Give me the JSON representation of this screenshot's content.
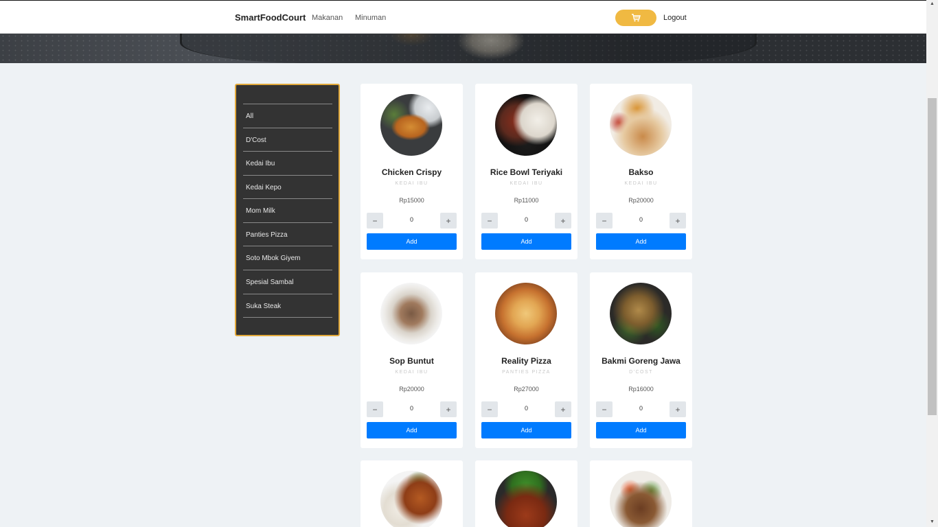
{
  "header": {
    "brand": "SmartFoodCourt",
    "nav": [
      "Makanan",
      "Minuman"
    ],
    "logout": "Logout"
  },
  "sidebar": {
    "items": [
      "All",
      "D'Cost",
      "Kedai Ibu",
      "Kedai Kepo",
      "Mom Milk",
      "Panties Pizza",
      "Soto Mbok Giyem",
      "Spesial Sambal",
      "Suka Steak"
    ]
  },
  "products": [
    {
      "name": "Chicken Crispy",
      "shop": "KEDAI IBU",
      "price": "Rp15000",
      "qty": "0",
      "add_label": "Add",
      "img": "chicken-crispy-photo"
    },
    {
      "name": "Rice Bowl Teriyaki",
      "shop": "KEDAI IBU",
      "price": "Rp11000",
      "qty": "0",
      "add_label": "Add",
      "img": "rice-bowl-photo"
    },
    {
      "name": "Bakso",
      "shop": "KEDAI IBU",
      "price": "Rp20000",
      "qty": "0",
      "add_label": "Add",
      "img": "bakso-photo"
    },
    {
      "name": "Sop Buntut",
      "shop": "KEDAI IBU",
      "price": "Rp20000",
      "qty": "0",
      "add_label": "Add",
      "img": "sop-buntut-photo"
    },
    {
      "name": "Reality Pizza",
      "shop": "PANTIES PIZZA",
      "price": "Rp27000",
      "qty": "0",
      "add_label": "Add",
      "img": "pizza-photo"
    },
    {
      "name": "Bakmi Goreng Jawa",
      "shop": "D'COST",
      "price": "Rp16000",
      "qty": "0",
      "add_label": "Add",
      "img": "bakmi-photo"
    }
  ],
  "qty_controls": {
    "minus": "−",
    "plus": "+"
  },
  "icons": {
    "cart": "cart-icon"
  },
  "colors": {
    "accent": "#f0b942",
    "primary": "#007bff",
    "sidebar_bg": "#333333",
    "sidebar_border": "#e2a93a"
  }
}
